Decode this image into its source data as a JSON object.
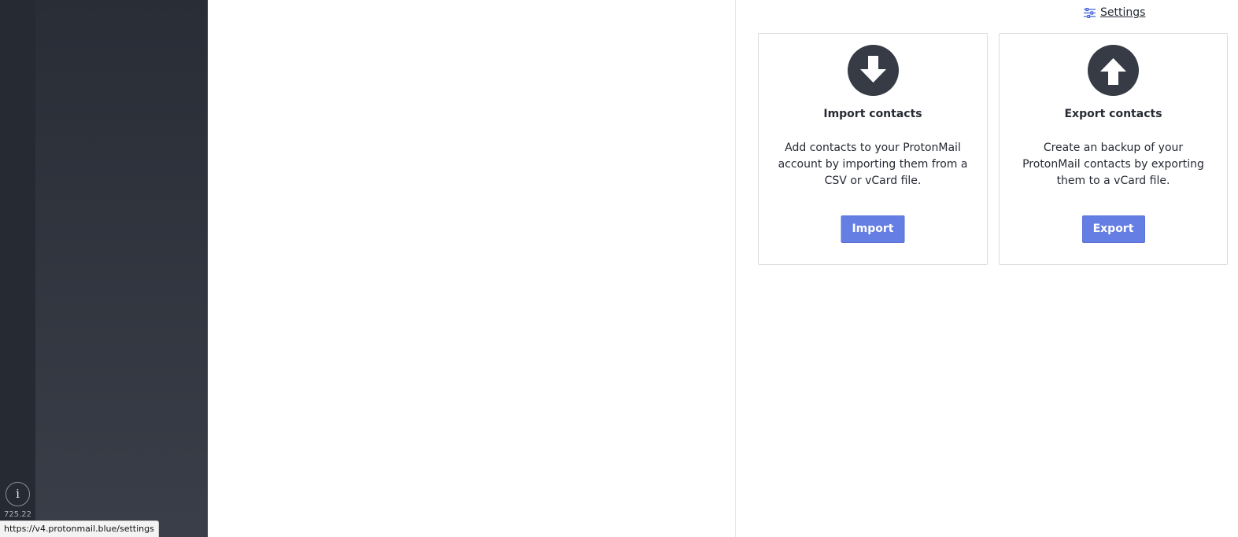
{
  "rail": {
    "info_icon": "info-icon",
    "info_glyph": "i",
    "version": "725.22"
  },
  "header": {
    "settings_label": "Settings",
    "settings_icon": "sliders-icon"
  },
  "cards": {
    "import": {
      "icon": "arrow-down-circle-icon",
      "title": "Import contacts",
      "description": "Add contacts to your ProtonMail account by importing them from a CSV or vCard file.",
      "button_label": "Import"
    },
    "export": {
      "icon": "arrow-up-circle-icon",
      "title": "Export contacts",
      "description": "Create an backup of your ProtonMail contacts by exporting them to a vCard file.",
      "button_label": "Export"
    }
  },
  "status_bar": {
    "url": "https://v4.protonmail.blue/settings"
  },
  "colors": {
    "rail": "#262a33",
    "sidebar_top": "#292d36",
    "sidebar_bottom": "#3a3e48",
    "icon_circle": "#373b45",
    "primary_button": "#657ee4"
  }
}
